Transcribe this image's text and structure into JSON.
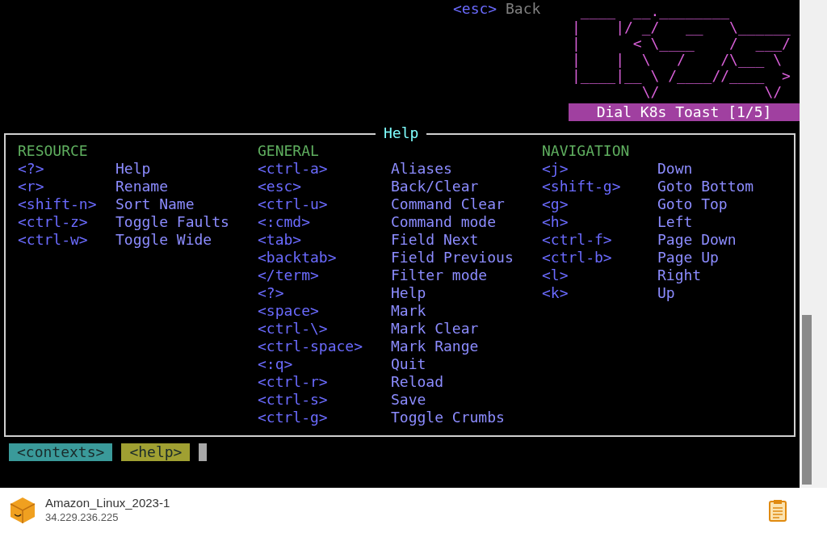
{
  "top_hint": {
    "key": "<esc>",
    "action": "Back"
  },
  "logo": {
    "lines": [
      " ____  __.________       ",
      "|    |/ _/   __   \\______",
      "|      < \\____    /  ___/",
      "|    |  \\   /    /\\___ \\ ",
      "|____|__ \\ /____//____  >",
      "        \\/            \\/ "
    ],
    "toast": "Dial K8s Toast [1/5]"
  },
  "help": {
    "title": "Help",
    "sections": [
      {
        "title": "RESOURCE",
        "items": [
          {
            "key": "<?>",
            "action": "Help"
          },
          {
            "key": "<r>",
            "action": "Rename"
          },
          {
            "key": "<shift-n>",
            "action": "Sort Name"
          },
          {
            "key": "<ctrl-z>",
            "action": "Toggle Faults"
          },
          {
            "key": "<ctrl-w>",
            "action": "Toggle Wide"
          }
        ]
      },
      {
        "title": "GENERAL",
        "items": [
          {
            "key": "<ctrl-a>",
            "action": "Aliases"
          },
          {
            "key": "<esc>",
            "action": "Back/Clear"
          },
          {
            "key": "<ctrl-u>",
            "action": "Command Clear"
          },
          {
            "key": "<:cmd>",
            "action": "Command mode"
          },
          {
            "key": "<tab>",
            "action": "Field Next"
          },
          {
            "key": "<backtab>",
            "action": "Field Previous"
          },
          {
            "key": "</term>",
            "action": "Filter mode"
          },
          {
            "key": "<?>",
            "action": "Help"
          },
          {
            "key": "<space>",
            "action": "Mark"
          },
          {
            "key": "<ctrl-\\>",
            "action": "Mark Clear"
          },
          {
            "key": "<ctrl-space>",
            "action": "Mark Range"
          },
          {
            "key": "<:q>",
            "action": "Quit"
          },
          {
            "key": "<ctrl-r>",
            "action": "Reload"
          },
          {
            "key": "<ctrl-s>",
            "action": "Save"
          },
          {
            "key": "<ctrl-g>",
            "action": "Toggle Crumbs"
          }
        ]
      },
      {
        "title": "NAVIGATION",
        "items": [
          {
            "key": "<j>",
            "action": "Down"
          },
          {
            "key": "<shift-g>",
            "action": "Goto Bottom"
          },
          {
            "key": "<g>",
            "action": "Goto Top"
          },
          {
            "key": "<h>",
            "action": "Left"
          },
          {
            "key": "<ctrl-f>",
            "action": "Page Down"
          },
          {
            "key": "<ctrl-b>",
            "action": "Page Up"
          },
          {
            "key": "<l>",
            "action": "Right"
          },
          {
            "key": "<k>",
            "action": "Up"
          }
        ]
      }
    ]
  },
  "crumbs": [
    {
      "label": "<contexts>",
      "kind": "previous"
    },
    {
      "label": "<help>",
      "kind": "current"
    }
  ],
  "footer": {
    "name": "Amazon_Linux_2023-1",
    "address": "34.229.236.225"
  }
}
